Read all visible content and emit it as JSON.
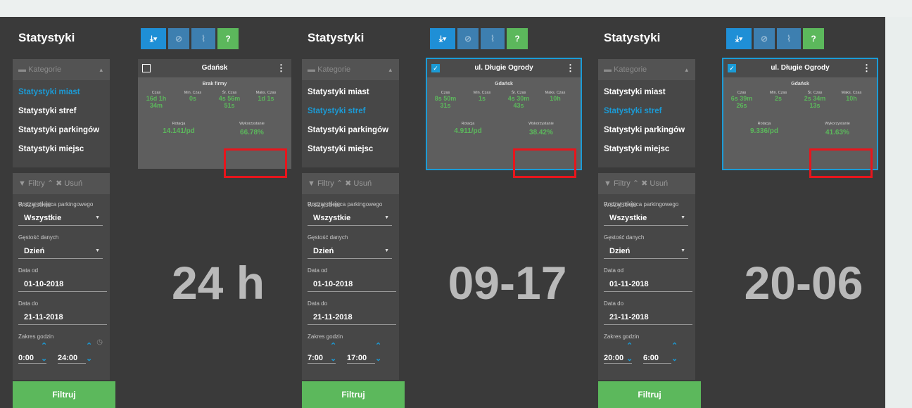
{
  "panels": [
    {
      "title": "Statystyki",
      "categories_header": "Kategorie",
      "categories": [
        "Statystyki miast",
        "Statystyki stref",
        "Statystyki parkingów",
        "Statystyki miejsc"
      ],
      "active_category": 0,
      "filters_header": "Filtry",
      "clear_all": "Usuń wszystkie",
      "parking_type_label": "Rodzaj miejsca parkingowego",
      "parking_type_value": "Wszystkie",
      "density_label": "Gęstość danych",
      "density_value": "Dzień",
      "date_from_label": "Data od",
      "date_from_value": "01-10-2018",
      "date_to_label": "Data do",
      "date_to_value": "21-11-2018",
      "hours_label": "Zakres godzin",
      "hour_from": "0:00",
      "hour_to": "24:00",
      "filter_button": "Filtruj",
      "card": {
        "checked": false,
        "title": "Gdańsk",
        "subtitle": "Brak firmy",
        "stats": [
          {
            "label": "Czas",
            "value": "16d 1h 34m"
          },
          {
            "label": "Min. Czas",
            "value": "0s"
          },
          {
            "label": "Śr. Czas",
            "value": "4s 56m 51s"
          },
          {
            "label": "Maks. Czas",
            "value": "1d 1s"
          }
        ],
        "left_label": "Rotacja",
        "left_value": "14.141/pd",
        "right_label": "Wykorzystanie",
        "right_value": "66.78%"
      },
      "big_label": "24 h"
    },
    {
      "title": "Statystyki",
      "categories_header": "Kategorie",
      "categories": [
        "Statystyki miast",
        "Statystyki stref",
        "Statystyki parkingów",
        "Statystyki miejsc"
      ],
      "active_category": 1,
      "filters_header": "Filtry",
      "clear_all": "Usuń wszystkie",
      "parking_type_label": "Rodzaj miejsca parkingowego",
      "parking_type_value": "Wszystkie",
      "density_label": "Gęstość danych",
      "density_value": "Dzień",
      "date_from_label": "Data od",
      "date_from_value": "01-10-2018",
      "date_to_label": "Data do",
      "date_to_value": "21-11-2018",
      "hours_label": "Zakres godzin",
      "hour_from": "7:00",
      "hour_to": "17:00",
      "filter_button": "Filtruj",
      "card": {
        "checked": true,
        "title": "ul. Długie Ogrody",
        "subtitle": "Gdańsk",
        "stats": [
          {
            "label": "Czas",
            "value": "8s 50m 31s"
          },
          {
            "label": "Min. Czas",
            "value": "1s"
          },
          {
            "label": "Śr. Czas",
            "value": "4s 30m 43s"
          },
          {
            "label": "Maks. Czas",
            "value": "10h"
          }
        ],
        "left_label": "Rotacja",
        "left_value": "4.911/pd",
        "right_label": "Wykorzystanie",
        "right_value": "38.42%"
      },
      "big_label": "09-17"
    },
    {
      "title": "Statystyki",
      "categories_header": "Kategorie",
      "categories": [
        "Statystyki miast",
        "Statystyki stref",
        "Statystyki parkingów",
        "Statystyki miejsc"
      ],
      "active_category": 1,
      "filters_header": "Filtry",
      "clear_all": "Usuń wszystkie",
      "parking_type_label": "Rodzaj miejsca parkingowego",
      "parking_type_value": "Wszystkie",
      "density_label": "Gęstość danych",
      "density_value": "Dzień",
      "date_from_label": "Data od",
      "date_from_value": "01-11-2018",
      "date_to_label": "Data do",
      "date_to_value": "21-11-2018",
      "hours_label": "Zakres godzin",
      "hour_from": "20:00",
      "hour_to": "6:00",
      "filter_button": "Filtruj",
      "card": {
        "checked": true,
        "title": "ul. Długie Ogrody",
        "subtitle": "Gdańsk",
        "stats": [
          {
            "label": "Czas",
            "value": "6s 39m 26s"
          },
          {
            "label": "Min. Czas",
            "value": "2s"
          },
          {
            "label": "Śr. Czas",
            "value": "2s 34m 13s"
          },
          {
            "label": "Maks. Czas",
            "value": "10h"
          }
        ],
        "left_label": "Rotacja",
        "left_value": "9.336/pd",
        "right_label": "Wykorzystanie",
        "right_value": "41.63%"
      },
      "big_label": "20-06"
    }
  ],
  "toolbar_icons": [
    "download-icon",
    "ban-icon",
    "chart-icon",
    "help-icon"
  ],
  "colors": {
    "accent": "#1b9bd6",
    "success": "#5cb85c",
    "highlight": "#e8151c",
    "background": "#3a3a3a"
  }
}
